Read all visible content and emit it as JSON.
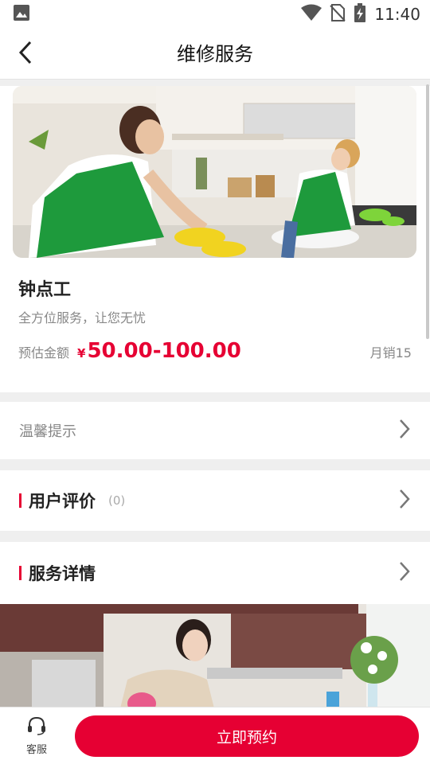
{
  "status_bar": {
    "time": "11:40"
  },
  "header": {
    "title": "维修服务"
  },
  "service": {
    "name": "钟点工",
    "subtitle": "全方位服务，让您无忧",
    "price_label": "预估金额",
    "currency": "¥",
    "price": "50.00-100.00",
    "sales": "月销15"
  },
  "tip_row": {
    "label": "温馨提示"
  },
  "reviews": {
    "title": "用户评价",
    "count": "(0)"
  },
  "details": {
    "title": "服务详情"
  },
  "bottom_bar": {
    "service_label": "客服",
    "book_label": "立即预约"
  },
  "colors": {
    "accent": "#e60033",
    "background": "#efefef",
    "apron": "#1e9a3c",
    "glove": "#f1d320"
  },
  "icons": [
    "image-icon",
    "wifi-icon",
    "no-sim-icon",
    "battery-charging-icon",
    "back-arrow-icon",
    "chevron-right-icon",
    "headset-icon"
  ]
}
